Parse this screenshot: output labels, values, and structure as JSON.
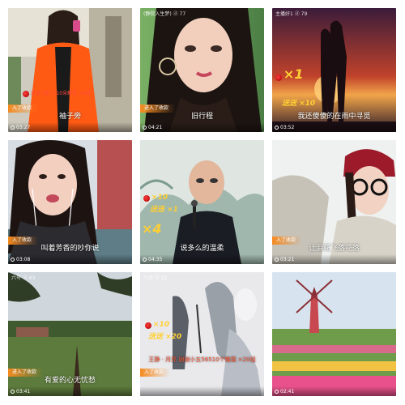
{
  "tiles": [
    {
      "caption": "袖子旁",
      "time": "03:27",
      "badge": "入了收款",
      "top_text": "",
      "gift_line": "送送 (送) ×10朵鲜花 ×8朵"
    },
    {
      "caption": "旧行程",
      "time": "04:21",
      "badge": "进入了收款",
      "top_text": "(静院入生梦) ⓓ 77",
      "gift_line": ""
    },
    {
      "caption": "我还傻傻的在雨中寻觅",
      "time": "03:52",
      "badge": "",
      "top_text": "主播好1 ⓓ 79",
      "gift_line": "×1",
      "gift_line2": "送送 ×10"
    },
    {
      "caption": "叫着芳香的吵你说",
      "time": "03:08",
      "badge": "入了收款",
      "top_text": "",
      "gift_line": ""
    },
    {
      "caption": "说多么的温柔",
      "time": "04:35",
      "badge": "",
      "top_text": "",
      "gift_line": "×10",
      "gift_line2": "送送 ×1",
      "gift_line3": "×4"
    },
    {
      "caption": "让泪花飞落花落",
      "time": "03:21",
      "badge": "入了收款",
      "top_text": "",
      "gift_line": ""
    },
    {
      "caption": "有爱的心无忧愁",
      "time": "03:41",
      "badge": "进入了收款",
      "top_text": "六号 ⓓ 63",
      "gift_line": ""
    },
    {
      "caption": "王静 · 月亮  谢谢小五56510个糖霜 ×20组",
      "time": "",
      "badge": "入了收款",
      "top_text": "六月 ⓓ 11",
      "gift_line": "×10",
      "gift_line2": "送送 ×20"
    },
    {
      "caption": "",
      "time": "02:41",
      "badge": "",
      "top_text": "",
      "gift_line": ""
    }
  ]
}
